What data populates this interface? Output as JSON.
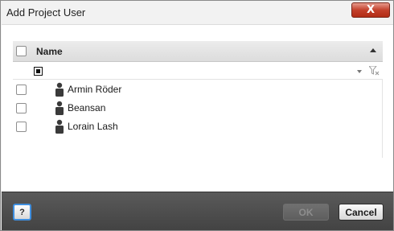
{
  "window": {
    "title": "Add Project User",
    "close_glyph": "X"
  },
  "grid": {
    "header": {
      "column_name": "Name",
      "sort": "ascending"
    },
    "filter_row": {
      "value": ""
    },
    "rows": [
      {
        "name": "Armin Röder",
        "checked": false
      },
      {
        "name": "Beansan",
        "checked": false
      },
      {
        "name": "Lorain Lash",
        "checked": false
      }
    ]
  },
  "footer": {
    "help_label": "?",
    "ok_label": "OK",
    "ok_enabled": false,
    "cancel_label": "Cancel"
  },
  "colors": {
    "accent": "#3f8fe0",
    "close_button": "#c3402b",
    "footer_bg": "#4c4c4c"
  },
  "icons": {
    "close": "close-icon",
    "sort": "sort-ascending-icon",
    "filter_dropdown": "chevron-down-icon",
    "clear_filter": "clear-filter-icon",
    "user": "user-icon"
  }
}
